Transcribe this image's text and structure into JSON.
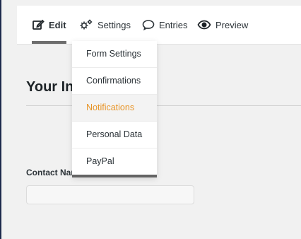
{
  "toolbar": {
    "tabs": [
      {
        "label": "Edit",
        "icon": "edit-icon"
      },
      {
        "label": "Settings",
        "icon": "gears-icon"
      },
      {
        "label": "Entries",
        "icon": "comment-icon"
      },
      {
        "label": "Preview",
        "icon": "eye-icon"
      }
    ]
  },
  "settings_menu": {
    "items": [
      {
        "label": "Form Settings"
      },
      {
        "label": "Confirmations"
      },
      {
        "label": "Notifications",
        "active": true
      },
      {
        "label": "Personal Data"
      },
      {
        "label": "PayPal"
      }
    ],
    "active_color": "#e89528"
  },
  "form": {
    "title": "Your In",
    "field_label": "Contact Name",
    "field_value": ""
  },
  "colors": {
    "sidebar": "#1d2a4d",
    "background": "#f1f1f1",
    "accent": "#e89528"
  }
}
